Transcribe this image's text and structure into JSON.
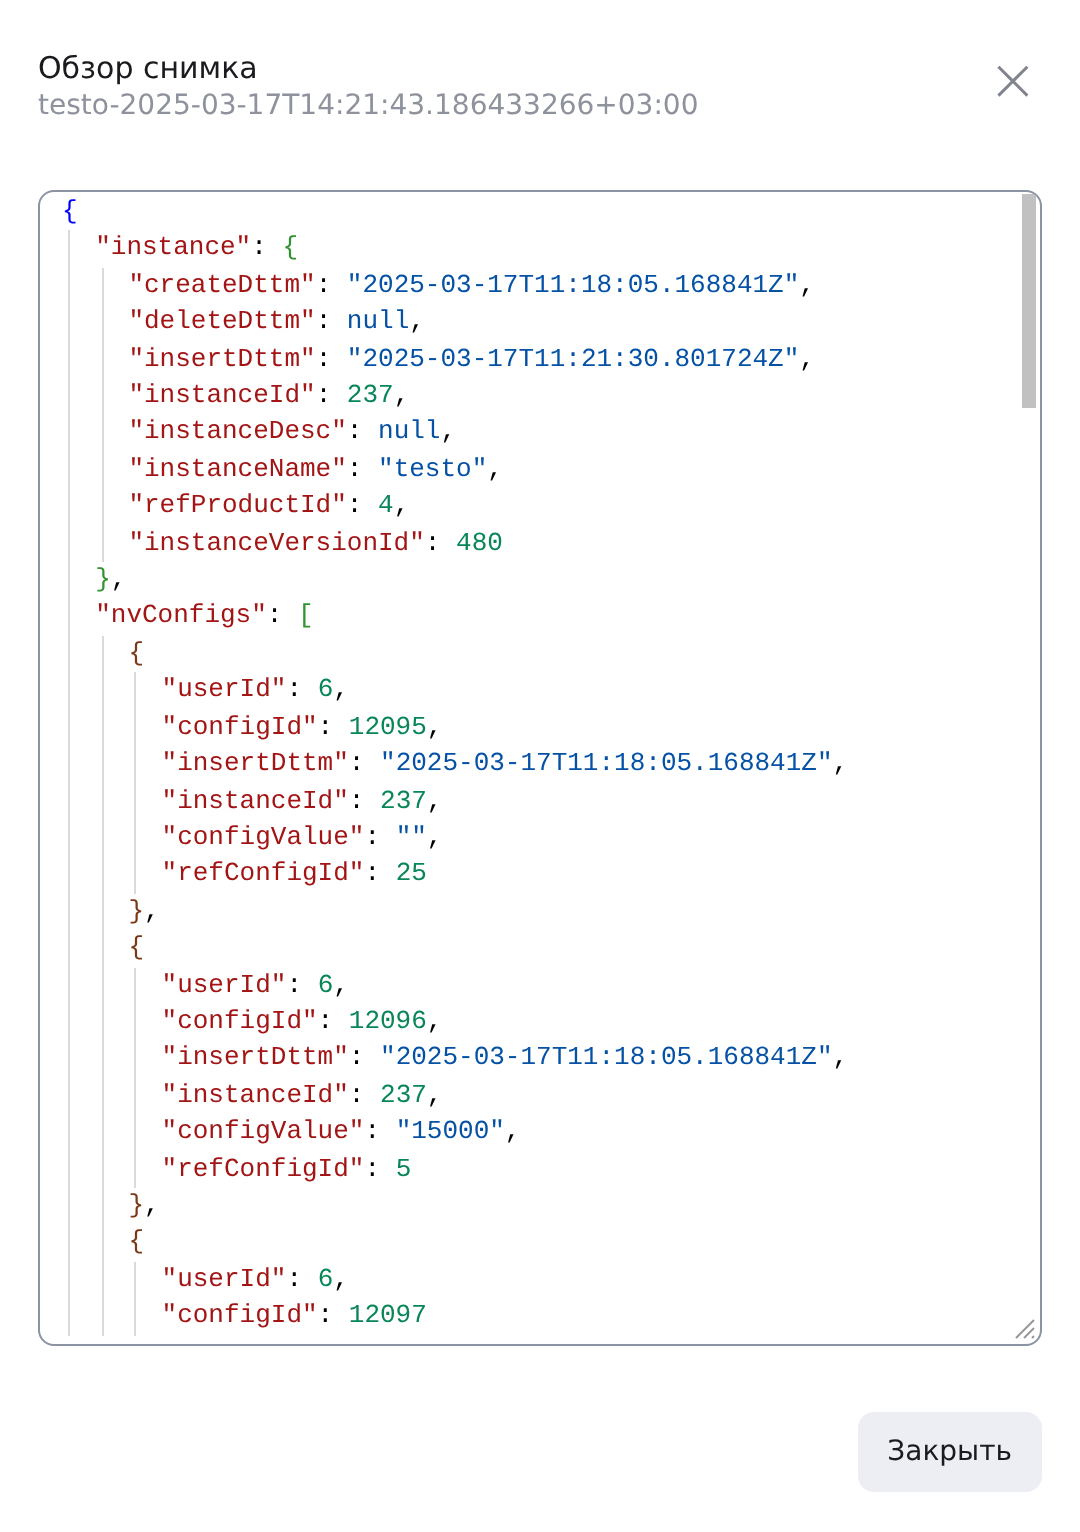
{
  "dialog": {
    "title": "Обзор снимка",
    "subtitle": "testo-2025-03-17T14:21:43.186433266+03:00",
    "close_icon": "×"
  },
  "code": {
    "lines": [
      {
        "tokens": [
          {
            "kind": "bracket",
            "text": "{",
            "color": "#0000ff"
          }
        ],
        "children": [
          {
            "tokens": [
              {
                "kind": "key",
                "text": "\"instance\""
              },
              {
                "kind": "punct",
                "text": ": "
              },
              {
                "kind": "bracket",
                "text": "{",
                "color": "#319331"
              }
            ],
            "children": [
              {
                "tokens": [
                  {
                    "kind": "key",
                    "text": "\"createDttm\""
                  },
                  {
                    "kind": "punct",
                    "text": ": "
                  },
                  {
                    "kind": "string",
                    "text": "\"2025-03-17T11:18:05.168841Z\""
                  },
                  {
                    "kind": "punct",
                    "text": ","
                  }
                ]
              },
              {
                "tokens": [
                  {
                    "kind": "key",
                    "text": "\"deleteDttm\""
                  },
                  {
                    "kind": "punct",
                    "text": ": "
                  },
                  {
                    "kind": "null",
                    "text": "null"
                  },
                  {
                    "kind": "punct",
                    "text": ","
                  }
                ]
              },
              {
                "tokens": [
                  {
                    "kind": "key",
                    "text": "\"insertDttm\""
                  },
                  {
                    "kind": "punct",
                    "text": ": "
                  },
                  {
                    "kind": "string",
                    "text": "\"2025-03-17T11:21:30.801724Z\""
                  },
                  {
                    "kind": "punct",
                    "text": ","
                  }
                ]
              },
              {
                "tokens": [
                  {
                    "kind": "key",
                    "text": "\"instanceId\""
                  },
                  {
                    "kind": "punct",
                    "text": ": "
                  },
                  {
                    "kind": "number",
                    "text": "237"
                  },
                  {
                    "kind": "punct",
                    "text": ","
                  }
                ]
              },
              {
                "tokens": [
                  {
                    "kind": "key",
                    "text": "\"instanceDesc\""
                  },
                  {
                    "kind": "punct",
                    "text": ": "
                  },
                  {
                    "kind": "null",
                    "text": "null"
                  },
                  {
                    "kind": "punct",
                    "text": ","
                  }
                ]
              },
              {
                "tokens": [
                  {
                    "kind": "key",
                    "text": "\"instanceName\""
                  },
                  {
                    "kind": "punct",
                    "text": ": "
                  },
                  {
                    "kind": "string",
                    "text": "\"testo\""
                  },
                  {
                    "kind": "punct",
                    "text": ","
                  }
                ]
              },
              {
                "tokens": [
                  {
                    "kind": "key",
                    "text": "\"refProductId\""
                  },
                  {
                    "kind": "punct",
                    "text": ": "
                  },
                  {
                    "kind": "number",
                    "text": "4"
                  },
                  {
                    "kind": "punct",
                    "text": ","
                  }
                ]
              },
              {
                "tokens": [
                  {
                    "kind": "key",
                    "text": "\"instanceVersionId\""
                  },
                  {
                    "kind": "punct",
                    "text": ": "
                  },
                  {
                    "kind": "number",
                    "text": "480"
                  }
                ]
              }
            ]
          },
          {
            "tokens": [
              {
                "kind": "bracket",
                "text": "}",
                "color": "#319331"
              },
              {
                "kind": "punct",
                "text": ","
              }
            ]
          },
          {
            "tokens": [
              {
                "kind": "key",
                "text": "\"nvConfigs\""
              },
              {
                "kind": "punct",
                "text": ": "
              },
              {
                "kind": "bracket",
                "text": "[",
                "color": "#319331"
              }
            ],
            "children": [
              {
                "tokens": [
                  {
                    "kind": "bracket",
                    "text": "{",
                    "color": "#7b3814"
                  }
                ],
                "children": [
                  {
                    "tokens": [
                      {
                        "kind": "key",
                        "text": "\"userId\""
                      },
                      {
                        "kind": "punct",
                        "text": ": "
                      },
                      {
                        "kind": "number",
                        "text": "6"
                      },
                      {
                        "kind": "punct",
                        "text": ","
                      }
                    ]
                  },
                  {
                    "tokens": [
                      {
                        "kind": "key",
                        "text": "\"configId\""
                      },
                      {
                        "kind": "punct",
                        "text": ": "
                      },
                      {
                        "kind": "number",
                        "text": "12095"
                      },
                      {
                        "kind": "punct",
                        "text": ","
                      }
                    ]
                  },
                  {
                    "tokens": [
                      {
                        "kind": "key",
                        "text": "\"insertDttm\""
                      },
                      {
                        "kind": "punct",
                        "text": ": "
                      },
                      {
                        "kind": "string",
                        "text": "\"2025-03-17T11:18:05.168841Z\""
                      },
                      {
                        "kind": "punct",
                        "text": ","
                      }
                    ]
                  },
                  {
                    "tokens": [
                      {
                        "kind": "key",
                        "text": "\"instanceId\""
                      },
                      {
                        "kind": "punct",
                        "text": ": "
                      },
                      {
                        "kind": "number",
                        "text": "237"
                      },
                      {
                        "kind": "punct",
                        "text": ","
                      }
                    ]
                  },
                  {
                    "tokens": [
                      {
                        "kind": "key",
                        "text": "\"configValue\""
                      },
                      {
                        "kind": "punct",
                        "text": ": "
                      },
                      {
                        "kind": "string",
                        "text": "\"\""
                      },
                      {
                        "kind": "punct",
                        "text": ","
                      }
                    ]
                  },
                  {
                    "tokens": [
                      {
                        "kind": "key",
                        "text": "\"refConfigId\""
                      },
                      {
                        "kind": "punct",
                        "text": ": "
                      },
                      {
                        "kind": "number",
                        "text": "25"
                      }
                    ]
                  }
                ]
              },
              {
                "tokens": [
                  {
                    "kind": "bracket",
                    "text": "}",
                    "color": "#7b3814"
                  },
                  {
                    "kind": "punct",
                    "text": ","
                  }
                ]
              },
              {
                "tokens": [
                  {
                    "kind": "bracket",
                    "text": "{",
                    "color": "#7b3814"
                  }
                ],
                "children": [
                  {
                    "tokens": [
                      {
                        "kind": "key",
                        "text": "\"userId\""
                      },
                      {
                        "kind": "punct",
                        "text": ": "
                      },
                      {
                        "kind": "number",
                        "text": "6"
                      },
                      {
                        "kind": "punct",
                        "text": ","
                      }
                    ]
                  },
                  {
                    "tokens": [
                      {
                        "kind": "key",
                        "text": "\"configId\""
                      },
                      {
                        "kind": "punct",
                        "text": ": "
                      },
                      {
                        "kind": "number",
                        "text": "12096"
                      },
                      {
                        "kind": "punct",
                        "text": ","
                      }
                    ]
                  },
                  {
                    "tokens": [
                      {
                        "kind": "key",
                        "text": "\"insertDttm\""
                      },
                      {
                        "kind": "punct",
                        "text": ": "
                      },
                      {
                        "kind": "string",
                        "text": "\"2025-03-17T11:18:05.168841Z\""
                      },
                      {
                        "kind": "punct",
                        "text": ","
                      }
                    ]
                  },
                  {
                    "tokens": [
                      {
                        "kind": "key",
                        "text": "\"instanceId\""
                      },
                      {
                        "kind": "punct",
                        "text": ": "
                      },
                      {
                        "kind": "number",
                        "text": "237"
                      },
                      {
                        "kind": "punct",
                        "text": ","
                      }
                    ]
                  },
                  {
                    "tokens": [
                      {
                        "kind": "key",
                        "text": "\"configValue\""
                      },
                      {
                        "kind": "punct",
                        "text": ": "
                      },
                      {
                        "kind": "string",
                        "text": "\"15000\""
                      },
                      {
                        "kind": "punct",
                        "text": ","
                      }
                    ]
                  },
                  {
                    "tokens": [
                      {
                        "kind": "key",
                        "text": "\"refConfigId\""
                      },
                      {
                        "kind": "punct",
                        "text": ": "
                      },
                      {
                        "kind": "number",
                        "text": "5"
                      }
                    ]
                  }
                ]
              },
              {
                "tokens": [
                  {
                    "kind": "bracket",
                    "text": "}",
                    "color": "#7b3814"
                  },
                  {
                    "kind": "punct",
                    "text": ","
                  }
                ]
              },
              {
                "tokens": [
                  {
                    "kind": "bracket",
                    "text": "{",
                    "color": "#7b3814"
                  }
                ],
                "children": [
                  {
                    "tokens": [
                      {
                        "kind": "key",
                        "text": "\"userId\""
                      },
                      {
                        "kind": "punct",
                        "text": ": "
                      },
                      {
                        "kind": "number",
                        "text": "6"
                      },
                      {
                        "kind": "punct",
                        "text": ","
                      }
                    ]
                  },
                  {
                    "tokens": [
                      {
                        "kind": "key",
                        "text": "\"configId\""
                      },
                      {
                        "kind": "punct",
                        "text": ": "
                      },
                      {
                        "kind": "number",
                        "text": "12097"
                      }
                    ]
                  }
                ]
              }
            ]
          }
        ]
      }
    ]
  },
  "close_button": "Закрыть"
}
